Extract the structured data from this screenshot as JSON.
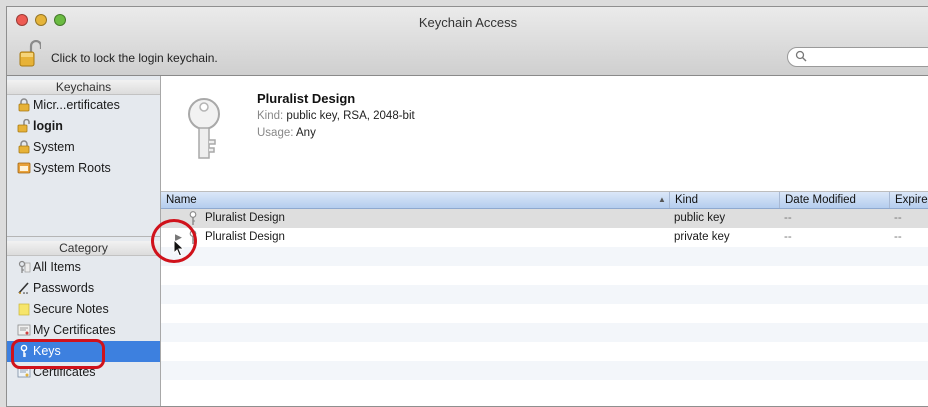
{
  "window": {
    "title": "Keychain Access",
    "lock_message": "Click to lock the login keychain.",
    "search_placeholder": ""
  },
  "sidebar": {
    "keychains_header": "Keychains",
    "keychains": [
      {
        "label": "Micr...ertificates",
        "icon": "lock-icon"
      },
      {
        "label": "login",
        "icon": "unlocked-lock-icon",
        "bold": true
      },
      {
        "label": "System",
        "icon": "lock-icon"
      },
      {
        "label": "System Roots",
        "icon": "folder-certificates-icon"
      }
    ],
    "category_header": "Category",
    "categories": [
      {
        "label": "All Items",
        "icon": "all-items-icon"
      },
      {
        "label": "Passwords",
        "icon": "pen-icon"
      },
      {
        "label": "Secure Notes",
        "icon": "note-icon"
      },
      {
        "label": "My Certificates",
        "icon": "my-certificates-icon"
      },
      {
        "label": "Keys",
        "icon": "key-icon",
        "selected": true
      },
      {
        "label": "Certificates",
        "icon": "certificate-icon"
      }
    ]
  },
  "detail": {
    "name": "Pluralist Design",
    "kind_label": "Kind:",
    "kind_value": "public key, RSA, 2048-bit",
    "usage_label": "Usage:",
    "usage_value": "Any"
  },
  "table": {
    "columns": [
      "Name",
      "Kind",
      "Date Modified",
      "Expire"
    ],
    "rows": [
      {
        "name": "Pluralist Design",
        "kind": "public key",
        "date": "--",
        "expire": "--"
      },
      {
        "name": "Pluralist Design",
        "kind": "private key",
        "date": "--",
        "expire": "--"
      }
    ]
  },
  "colors": {
    "selection": "#3d80df",
    "highlight": "#d0121b"
  }
}
